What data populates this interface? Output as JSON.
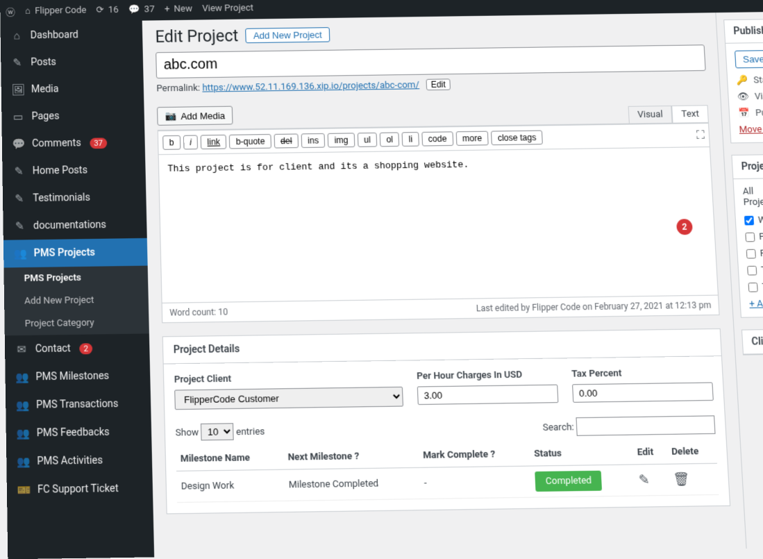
{
  "toolbar": {
    "site": "Flipper Code",
    "updates": "16",
    "comments": "37",
    "new": "New",
    "view": "View Project"
  },
  "sidebar": {
    "items": [
      {
        "icon": "⌂",
        "label": "Dashboard"
      },
      {
        "icon": "✎",
        "label": "Posts"
      },
      {
        "icon": "🖼",
        "label": "Media"
      },
      {
        "icon": "▭",
        "label": "Pages"
      },
      {
        "icon": "💬",
        "label": "Comments",
        "badge": "37"
      },
      {
        "icon": "✎",
        "label": "Home Posts"
      },
      {
        "icon": "✎",
        "label": "Testimonials"
      },
      {
        "icon": "✎",
        "label": "documentations"
      },
      {
        "icon": "👥",
        "label": "PMS Projects",
        "active": true
      },
      {
        "icon": "✉",
        "label": "Contact",
        "badge": "2"
      },
      {
        "icon": "👥",
        "label": "PMS Milestones"
      },
      {
        "icon": "👥",
        "label": "PMS Transactions"
      },
      {
        "icon": "👥",
        "label": "PMS Feedbacks"
      },
      {
        "icon": "👥",
        "label": "PMS Activities"
      },
      {
        "icon": "🎫",
        "label": "FC Support Ticket"
      }
    ],
    "submenu": [
      "PMS Projects",
      "Add New Project",
      "Project Category"
    ]
  },
  "page": {
    "heading": "Edit Project",
    "add_new": "Add New Project",
    "title_value": "abc.com",
    "permalink_label": "Permalink:",
    "permalink_url": "https://www.52.11.169.136.xip.io/projects/abc-com/",
    "permalink_edit": "Edit",
    "add_media": "Add Media",
    "tabs": {
      "visual": "Visual",
      "text": "Text"
    },
    "qt": [
      "b",
      "i",
      "link",
      "b-quote",
      "del",
      "ins",
      "img",
      "ul",
      "ol",
      "li",
      "code",
      "more",
      "close tags"
    ],
    "content": "This project is for client and its a shopping website.",
    "word_count_label": "Word count:",
    "word_count": "10",
    "last_edited": "Last edited by Flipper Code on February 27, 2021 at 12:13 pm",
    "circle": "2"
  },
  "metabox": {
    "title": "Project Details",
    "client_label": "Project Client",
    "client_value": "FlipperCode Customer",
    "hour_label": "Per Hour Charges In USD",
    "hour_value": "3.00",
    "tax_label": "Tax Percent",
    "tax_value": "0.00",
    "show": "Show",
    "show_n": "10",
    "entries": "entries",
    "search": "Search:",
    "cols": [
      "Milestone Name",
      "Next Milestone ?",
      "Mark Complete ?",
      "Status",
      "Edit",
      "Delete"
    ],
    "row": {
      "name": "Design Work",
      "next": "Milestone Completed",
      "mark": "-",
      "status": "Completed"
    }
  },
  "publish": {
    "title": "Publish",
    "save_draft": "Save Draft",
    "status": "Status",
    "visibility": "Visibility",
    "publish_on": "Publish",
    "trash": "Move to Trash"
  },
  "cats": {
    "title": "Project Categories",
    "tab": "All Projects",
    "items": [
      "Website",
      "Plugin",
      "Plugin",
      "Theme",
      "Theme"
    ],
    "add": "+ Add"
  },
  "client_panel": {
    "title": "Client"
  }
}
